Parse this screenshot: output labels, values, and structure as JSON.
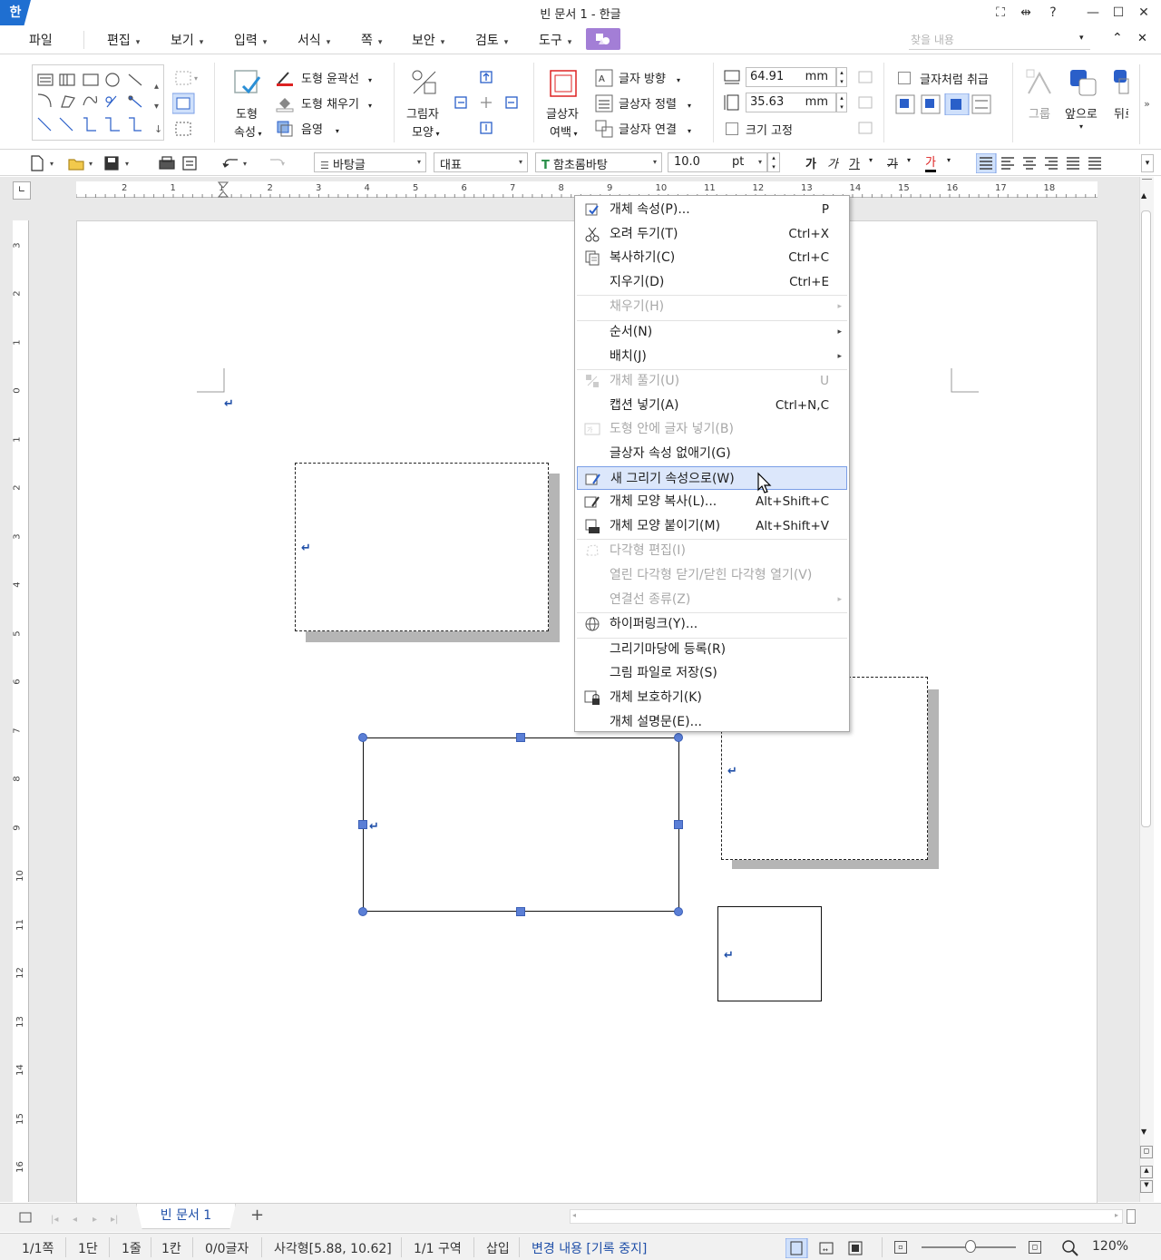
{
  "app": {
    "logo": "한",
    "title": "빈 문서 1 - 한글"
  },
  "window_buttons": {
    "fullscreen": "⛶",
    "split": "⇹",
    "help": "?",
    "minimize": "—",
    "maximize": "☐",
    "close": "✕"
  },
  "menubar": {
    "file": "파일",
    "items": [
      "편집",
      "보기",
      "입력",
      "서식",
      "쪽",
      "보안",
      "검토",
      "도구"
    ],
    "search_placeholder": "찾을 내용",
    "collapse": "⌃",
    "close": "✕"
  },
  "ribbon": {
    "shape_props": [
      "도형",
      "속성"
    ],
    "outline": "도형 윤곽선",
    "fill": "도형 채우기",
    "shadow": "음영",
    "pic_shape": [
      "그림자",
      "모양"
    ],
    "textbox_margin": [
      "글상자",
      "여백"
    ],
    "text_direction": "글자 방향",
    "textbox_align": "글상자 정렬",
    "textbox_link": "글상자 연결",
    "width_value": "64.91",
    "height_value": "35.63",
    "unit": "mm",
    "fixed_size": "크기 고정",
    "treat_as_char": "글자처럼 취급",
    "group": "그룹",
    "front": "앞으로",
    "back": "뒤로"
  },
  "fmtbar": {
    "style": "바탕글",
    "language": "대표",
    "font": "함초롬바탕",
    "size": "10.0",
    "size_unit": "pt",
    "bold": "가",
    "italic": "가",
    "underline": "가",
    "strike": "가",
    "color": "가"
  },
  "ruler": {
    "h_ticks": [
      "2",
      "1",
      "1",
      "2",
      "3",
      "4",
      "5",
      "6",
      "7",
      "8",
      "9",
      "10",
      "11",
      "12",
      "13",
      "14",
      "15",
      "16",
      "17",
      "18"
    ],
    "v_ticks": [
      "3",
      "2",
      "1",
      "0",
      "1",
      "2",
      "3",
      "4",
      "5",
      "6",
      "7",
      "8",
      "9",
      "10",
      "11",
      "12",
      "13",
      "14",
      "15",
      "16"
    ]
  },
  "context_menu": [
    {
      "label": "개체 속성(P)...",
      "shortcut": "P",
      "disabled": false,
      "icon": "properties-icon"
    },
    {
      "label": "오려 두기(T)",
      "shortcut": "Ctrl+X",
      "disabled": false,
      "icon": "scissors-icon"
    },
    {
      "label": "복사하기(C)",
      "shortcut": "Ctrl+C",
      "disabled": false,
      "icon": "copy-icon"
    },
    {
      "label": "지우기(D)",
      "shortcut": "Ctrl+E",
      "disabled": false,
      "icon": ""
    },
    {
      "label": "채우기(H)",
      "shortcut": "",
      "disabled": true,
      "submenu": true,
      "icon": ""
    },
    {
      "label": "순서(N)",
      "shortcut": "",
      "disabled": false,
      "submenu": true,
      "icon": ""
    },
    {
      "label": "배치(J)",
      "shortcut": "",
      "disabled": false,
      "submenu": true,
      "icon": ""
    },
    {
      "label": "개체 풀기(U)",
      "shortcut": "U",
      "disabled": true,
      "icon": "ungroup-icon"
    },
    {
      "label": "캡션 넣기(A)",
      "shortcut": "Ctrl+N,C",
      "disabled": false,
      "icon": ""
    },
    {
      "label": "도형 안에 글자 넣기(B)",
      "shortcut": "",
      "disabled": true,
      "icon": "text-in-shape-icon"
    },
    {
      "label": "글상자 속성 없애기(G)",
      "shortcut": "",
      "disabled": false,
      "icon": ""
    },
    {
      "label": "새 그리기 속성으로(W)",
      "shortcut": "",
      "disabled": false,
      "highlighted": true,
      "icon": "new-draw-props-icon"
    },
    {
      "label": "개체 모양 복사(L)...",
      "shortcut": "Alt+Shift+C",
      "disabled": false,
      "icon": "copy-style-icon"
    },
    {
      "label": "개체 모양 붙이기(M)",
      "shortcut": "Alt+Shift+V",
      "disabled": false,
      "icon": "paste-style-icon"
    },
    {
      "label": "다각형 편집(I)",
      "shortcut": "",
      "disabled": true,
      "icon": "polygon-edit-icon"
    },
    {
      "label": "열린 다각형 닫기/닫힌 다각형 열기(V)",
      "shortcut": "",
      "disabled": true,
      "icon": ""
    },
    {
      "label": "연결선 종류(Z)",
      "shortcut": "",
      "disabled": true,
      "submenu": true,
      "icon": ""
    },
    {
      "label": "하이퍼링크(Y)...",
      "shortcut": "",
      "disabled": false,
      "icon": "hyperlink-icon"
    },
    {
      "label": "그리기마당에 등록(R)",
      "shortcut": "",
      "disabled": false,
      "icon": ""
    },
    {
      "label": "그림 파일로 저장(S)",
      "shortcut": "",
      "disabled": false,
      "icon": ""
    },
    {
      "label": "개체 보호하기(K)",
      "shortcut": "",
      "disabled": false,
      "icon": "lock-icon"
    },
    {
      "label": "개체 설명문(E)...",
      "shortcut": "",
      "disabled": false,
      "icon": ""
    }
  ],
  "tabbar": {
    "doc_tab": "빈 문서 1",
    "add": "+"
  },
  "status": {
    "page": "1/1쪽",
    "column": "1단",
    "line": "1줄",
    "col": "1칸",
    "chars": "0/0글자",
    "object": "사각형[5.88, 10.62]",
    "section": "1/1 구역",
    "mode": "삽입",
    "track": "변경 내용 [기록 중지]",
    "zoom": "120%"
  },
  "zoom_level": 1.2,
  "colors": {
    "accent": "#1f6fd1",
    "tools_highlight": "#a37ed6",
    "handle": "#5b7fd6",
    "menu_highlight": "#dce7fb"
  }
}
